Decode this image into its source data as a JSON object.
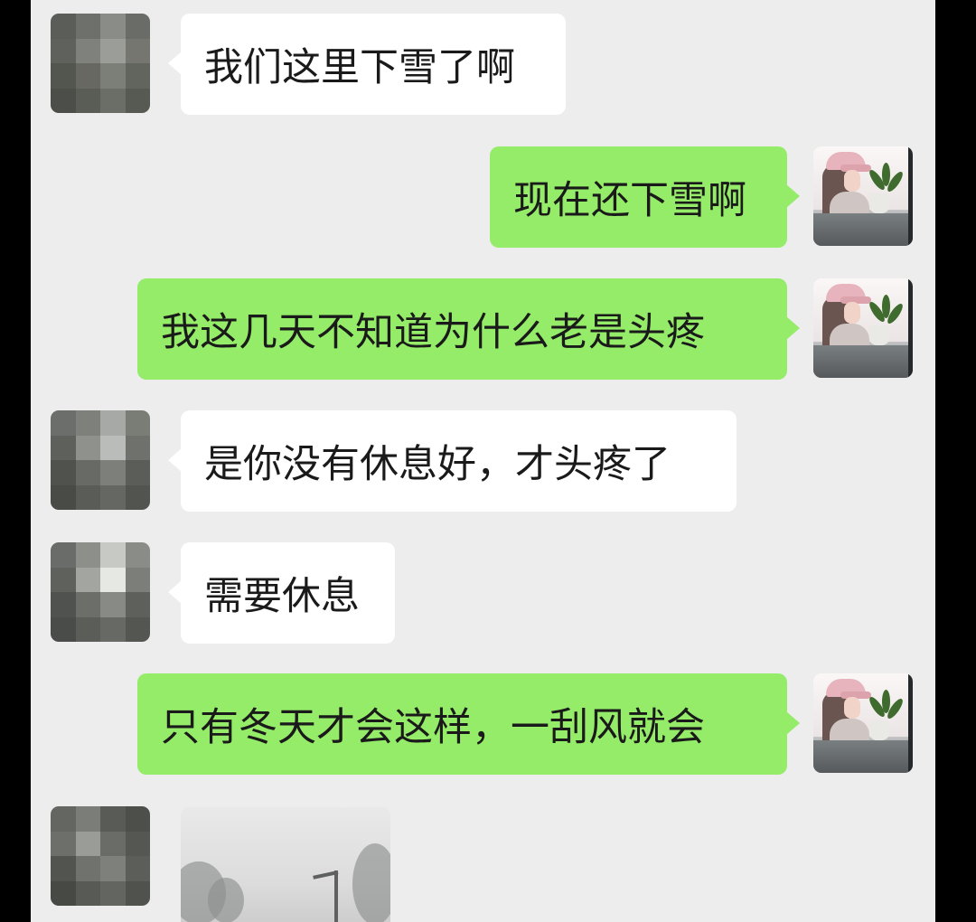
{
  "messages": [
    {
      "id": 1,
      "side": "left",
      "text": "我们这里下雪了啊"
    },
    {
      "id": 2,
      "side": "right",
      "text": "现在还下雪啊"
    },
    {
      "id": 3,
      "side": "right",
      "text": "我这几天不知道为什么老是头疼"
    },
    {
      "id": 4,
      "side": "left",
      "text": "是你没有休息好，才头疼了"
    },
    {
      "id": 5,
      "side": "left",
      "text": "需要休息"
    },
    {
      "id": 6,
      "side": "right",
      "text": "只有冬天才会这样，一刮风就会"
    },
    {
      "id": 7,
      "side": "left",
      "type": "image",
      "text": ""
    }
  ],
  "colors": {
    "background": "#ededed",
    "sent_bubble": "#95ec69",
    "received_bubble": "#ffffff",
    "text": "#1a1a1a"
  },
  "icons": {
    "contact_avatar": "pixelated-avatar",
    "self_avatar": "girl-with-plant-avatar"
  }
}
